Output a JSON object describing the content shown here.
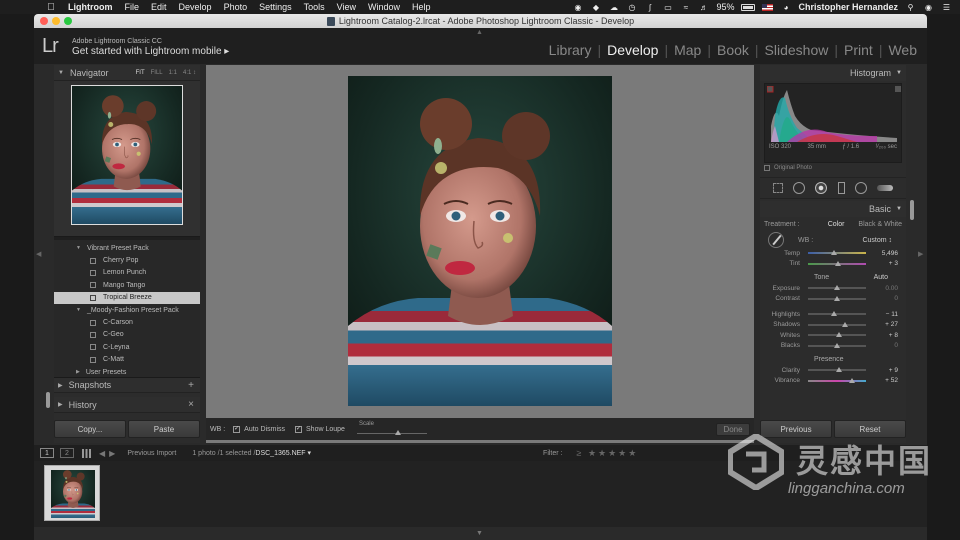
{
  "menubar": {
    "app_name": "Lightroom",
    "items": [
      "File",
      "Edit",
      "Develop",
      "Photo",
      "Settings",
      "Tools",
      "View",
      "Window",
      "Help"
    ],
    "battery": "95%",
    "user": "Christopher Hernandez"
  },
  "window": {
    "title": "Lightroom Catalog-2.lrcat - Adobe Photoshop Lightroom Classic - Develop"
  },
  "identity": {
    "logo": "Lr",
    "line1": "Adobe Lightroom Classic CC",
    "line2": "Get started with Lightroom mobile  ▸"
  },
  "modules": [
    "Library",
    "Develop",
    "Map",
    "Book",
    "Slideshow",
    "Print",
    "Web"
  ],
  "modules_active": "Develop",
  "left_panel": {
    "navigator_title": "Navigator",
    "nav_modes": [
      "FIT",
      "FILL",
      "1:1",
      "4:1 ↕"
    ],
    "presets": [
      {
        "type": "folder",
        "label": "Vibrant Preset Pack"
      },
      {
        "type": "item",
        "label": "Cherry Pop"
      },
      {
        "type": "item",
        "label": "Lemon Punch"
      },
      {
        "type": "item",
        "label": "Mango Tango"
      },
      {
        "type": "item",
        "label": "Tropical Breeze",
        "selected": true
      },
      {
        "type": "folder",
        "label": "_Moody-Fashion Preset Pack"
      },
      {
        "type": "item",
        "label": "C-Carson"
      },
      {
        "type": "item",
        "label": "C-Geo"
      },
      {
        "type": "item",
        "label": "C-Leyna"
      },
      {
        "type": "item",
        "label": "C-Matt"
      },
      {
        "type": "folder-closed",
        "label": "User Presets"
      }
    ],
    "snapshots_title": "Snapshots",
    "snapshots_action": "+",
    "history_title": "History",
    "history_action": "×",
    "copy_label": "Copy...",
    "paste_label": "Paste"
  },
  "toolbar": {
    "wb_label": "WB :",
    "auto_dismiss": "Auto Dismiss",
    "show_loupe": "Show Loupe",
    "scale_label": "Scale",
    "scale_value": 0.55,
    "done_label": "Done"
  },
  "right_panel": {
    "histogram_title": "Histogram",
    "iso": "ISO 320",
    "focal": "35 mm",
    "aperture": "ƒ / 1.6",
    "shutter": "¹⁄₂₀₀ sec",
    "original_photo": "Original Photo",
    "basic_title": "Basic",
    "treatment_label": "Treatment :",
    "treatment_color": "Color",
    "treatment_bw": "Black & White",
    "wb_label": "WB :",
    "wb_value": "Custom ↕",
    "tone_label": "Tone",
    "tone_auto": "Auto",
    "presence_label": "Presence",
    "sliders_wb": [
      {
        "label": "Temp",
        "value": "5,496",
        "pos": 0.44
      },
      {
        "label": "Tint",
        "value": "+ 3",
        "pos": 0.52
      }
    ],
    "sliders_tone": [
      {
        "label": "Exposure",
        "value": "0.00",
        "pos": 0.5,
        "muted": true
      },
      {
        "label": "Contrast",
        "value": "0",
        "pos": 0.5,
        "muted": true
      }
    ],
    "sliders_tone2": [
      {
        "label": "Highlights",
        "value": "− 11",
        "pos": 0.45
      },
      {
        "label": "Shadows",
        "value": "+ 27",
        "pos": 0.63
      },
      {
        "label": "Whites",
        "value": "+ 8",
        "pos": 0.54
      },
      {
        "label": "Blacks",
        "value": "0",
        "pos": 0.5,
        "muted": true
      }
    ],
    "sliders_presence": [
      {
        "label": "Clarity",
        "value": "+ 9",
        "pos": 0.54
      },
      {
        "label": "Vibrance",
        "value": "+ 52",
        "pos": 0.76
      }
    ],
    "previous_label": "Previous",
    "reset_label": "Reset"
  },
  "filmbar": {
    "screen1": "1",
    "screen2": "2",
    "source": "Previous Import",
    "selection_prefix": "1 photo /1 selected /",
    "filename": "DSC_1365.NEF ▾",
    "filter_label": "Filter :",
    "stars": "≥ ★★★★★"
  },
  "watermark": {
    "cn": "灵感中国",
    "en": "lingganchina.com"
  },
  "colors": {
    "window_bg": "#2a2a2a",
    "loupe_bg": "#7a7a7a",
    "selected_preset": "#c8c8c8",
    "accent_red": "#ff5f57",
    "accent_yellow": "#febc2e",
    "accent_green": "#28c840"
  },
  "icons": [
    "apple-icon",
    "wifi-icon",
    "volume-icon",
    "battery-icon",
    "flag-icon",
    "search-icon",
    "crop-icon",
    "spot-removal-icon",
    "red-eye-icon",
    "graduated-filter-icon",
    "radial-filter-icon",
    "brush-icon",
    "eyedropper-icon",
    "grid-icon"
  ]
}
